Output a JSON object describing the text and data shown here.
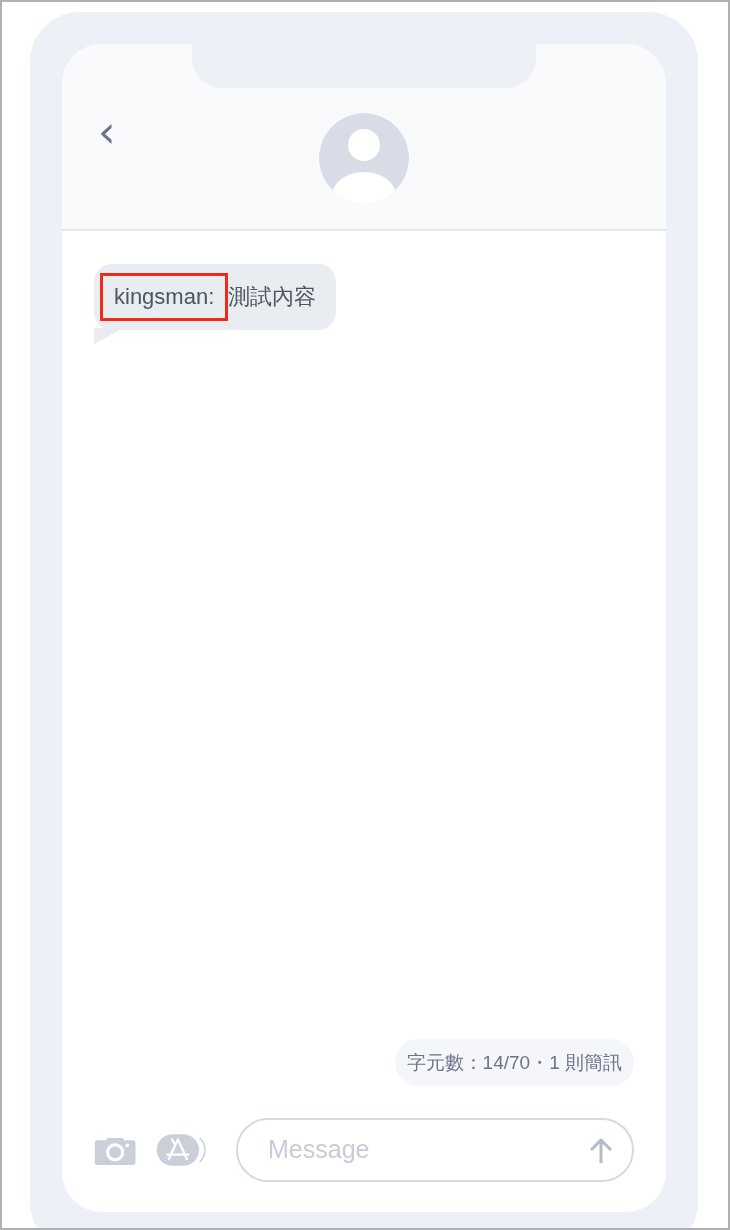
{
  "header": {
    "back": "‹"
  },
  "messages": [
    {
      "sender": "kingsman:",
      "text": "測試內容",
      "sender_highlighted": true
    }
  ],
  "counter": "字元數：14/70・1 則簡訊",
  "composer": {
    "placeholder": "Message"
  }
}
